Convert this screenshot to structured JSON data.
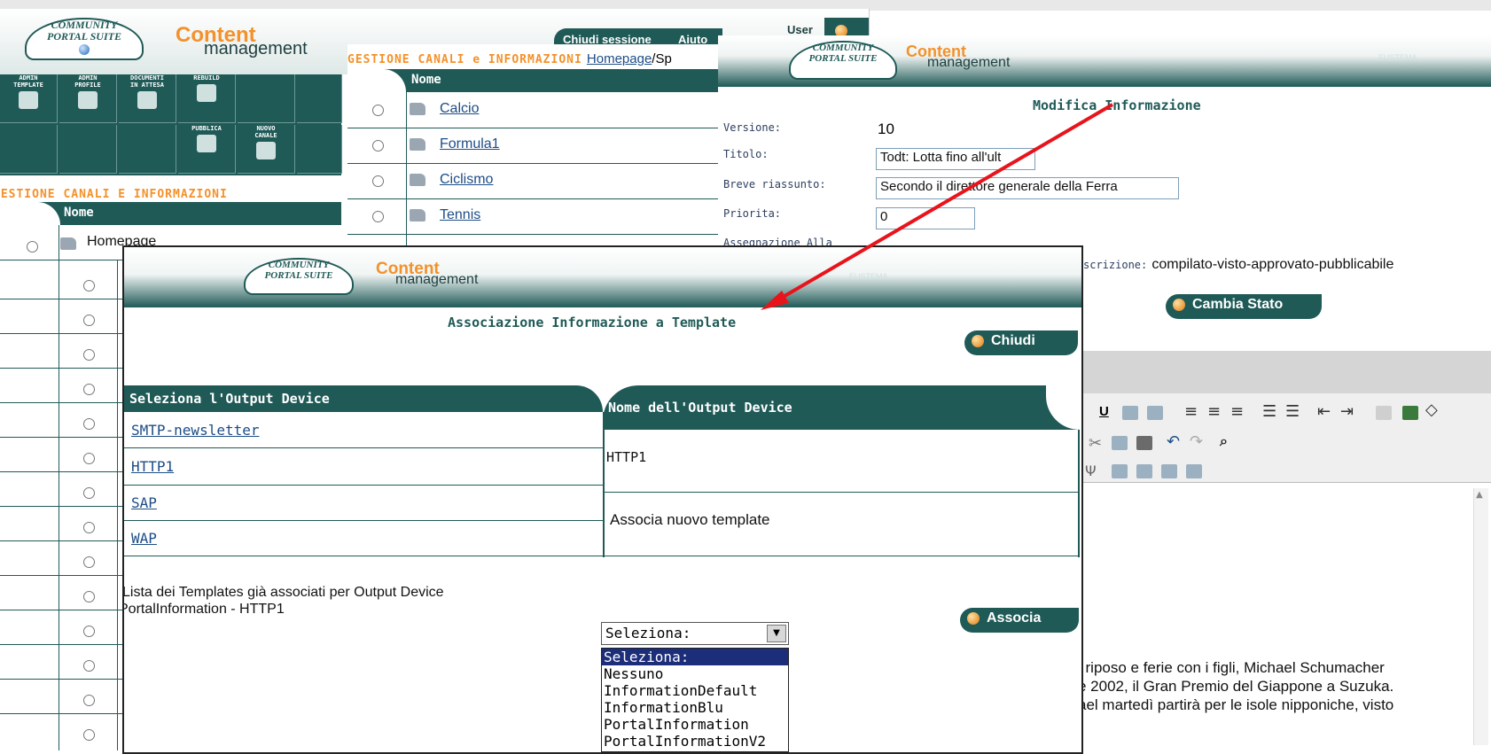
{
  "brand": {
    "logo_line1": "COMMUNITY",
    "logo_line2": "PORTAL SUITE",
    "content": "Content",
    "management": "management",
    "company": "EUSTEMA"
  },
  "window_a": {
    "session_tab": "Chiudi sessione",
    "help_tab": "Aiuto",
    "user_label": "User",
    "admin_buttons": [
      {
        "label": "ADMIN\nTEMPLATE",
        "icon": "gears-icon"
      },
      {
        "label": "ADMIN\nPROFILE",
        "icon": "folder-icon"
      },
      {
        "label": "DOCUMENTI\nIN ATTESA",
        "icon": "hand-icon"
      },
      {
        "label": "REBUILD",
        "icon": "bricks-icon"
      },
      {
        "label": "PUBBLICA",
        "icon": "megaphone-icon"
      },
      {
        "label": "NUOVO\nCANALE",
        "icon": "folder-icon"
      }
    ],
    "section_title": "GESTIONE CANALI E INFORMAZIONI",
    "column_header": "Nome",
    "root_item": "Homepage"
  },
  "window_channels": {
    "title": "GESTIONE CANALI e INFORMAZIONI",
    "breadcrumb_link": "Homepage",
    "breadcrumb_rest": "/Sp",
    "column_header": "Nome",
    "items": [
      "Calcio",
      "Formula1",
      "Ciclismo",
      "Tennis"
    ]
  },
  "window_b": {
    "page_title": "Modifica Informazione",
    "fields": {
      "versione_label": "Versione:",
      "versione_value": "10",
      "titolo_label": "Titolo:",
      "titolo_value": "Todt: Lotta fino all'ult",
      "riassunto_label": "Breve riassunto:",
      "riassunto_value": "Secondo il direttore generale della Ferra",
      "priorita_label": "Priorita:",
      "priorita_value": "0",
      "assegnazione_label": "Assegnazione Alla",
      "descrizione_label": "scrizione:",
      "descrizione_value": "compilato-visto-approvato-pubblicabile"
    },
    "cambia_stato": "Cambia Stato",
    "body_text": [
      "i riposo e ferie con i figli, Michael Schumacher",
      "e 2002, il Gran Premio del Giappone a Suzuka.",
      "ael martedì partirà per le isole nipponiche, visto"
    ]
  },
  "dialog": {
    "title": "Associazione Informazione a Template",
    "chiudi": "Chiudi",
    "col_select": "Seleziona l'Output Device",
    "col_name": "Nome dell'Output Device",
    "devices": [
      "SMTP-newsletter",
      "HTTP1",
      "SAP",
      "WAP"
    ],
    "device_name": "HTTP1",
    "associa_nuovo": "Associa nuovo template",
    "list_label_line1": "Lista dei Templates già associati per Output Device",
    "list_label_line2": "PortalInformation - HTTP1",
    "associa": "Associa",
    "select_value": "Seleziona:",
    "options": [
      "Seleziona:",
      "Nessuno",
      "InformationDefault",
      "InformationBlu",
      "PortalInformation",
      "PortalInformationV2"
    ]
  },
  "colors": {
    "brand_teal": "#1f5a57",
    "accent_orange": "#f4912a",
    "arrow_red": "#e8141c"
  }
}
